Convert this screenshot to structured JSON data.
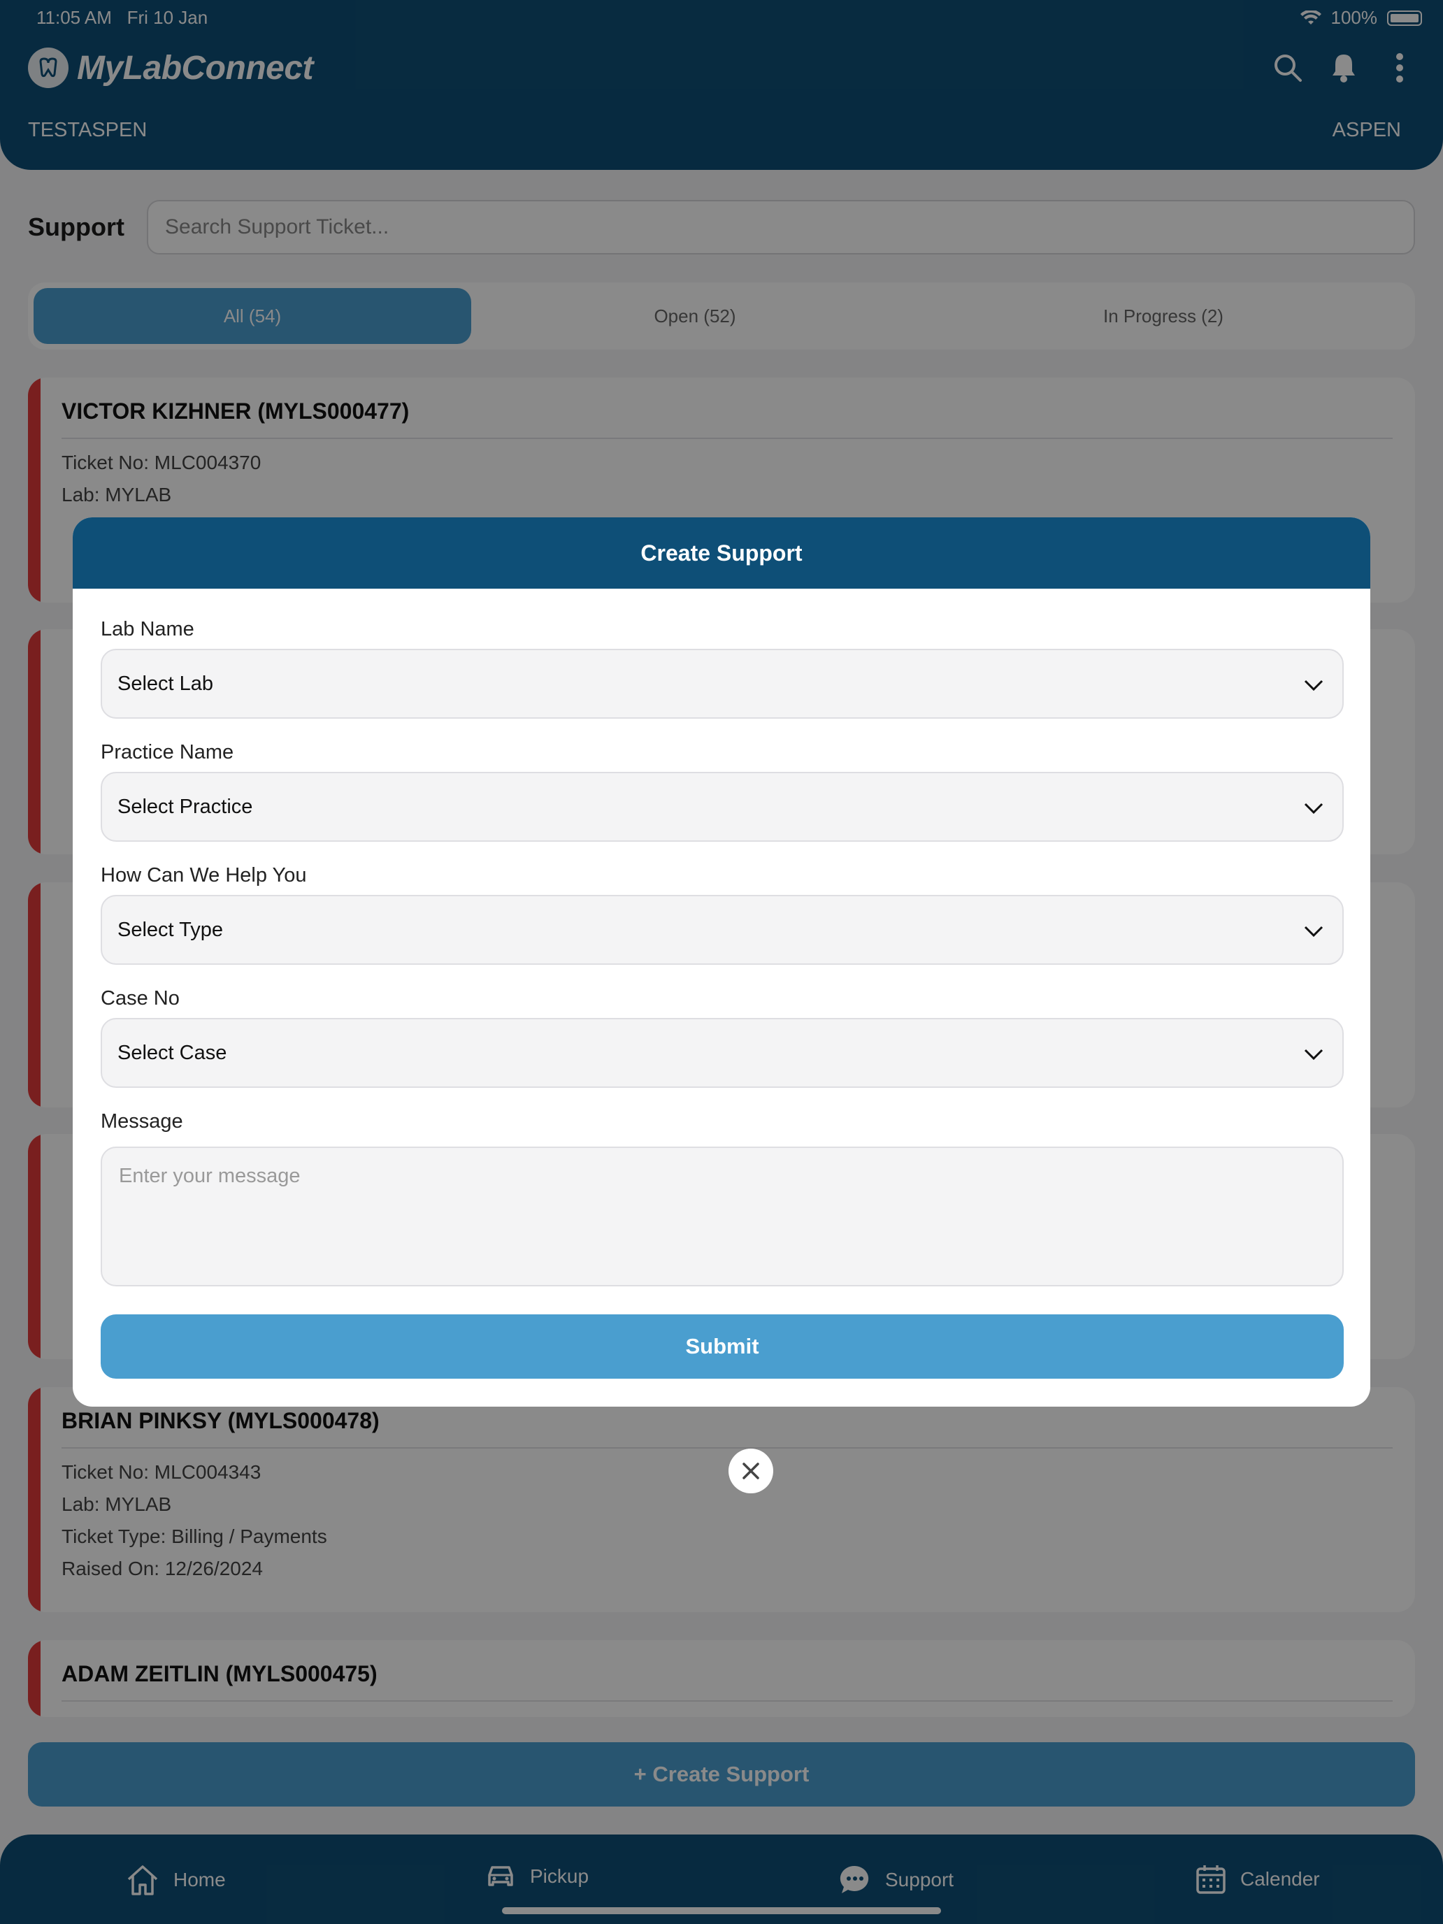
{
  "status_bar": {
    "time": "11:05 AM",
    "date": "Fri 10 Jan",
    "battery": "100%"
  },
  "header": {
    "app_name": "MyLabConnect",
    "org_left": "TESTASPEN",
    "org_right": "ASPEN",
    "icons": [
      "search-icon",
      "bell-icon",
      "more-vertical-icon"
    ]
  },
  "page": {
    "title": "Support",
    "search_placeholder": "Search Support Ticket..."
  },
  "tabs": [
    {
      "label": "All (54)",
      "active": true
    },
    {
      "label": "Open (52)",
      "active": false
    },
    {
      "label": "In Progress (2)",
      "active": false
    }
  ],
  "cards": [
    {
      "title": "VICTOR KIZHNER (MYLS000477)",
      "lines": [
        "Ticket No: MLC004370",
        "Lab: MYLAB"
      ]
    },
    {
      "title": "BRIAN PINKSY (MYLS000478)",
      "lines": [
        "Ticket No: MLC004343",
        "Lab: MYLAB",
        "Ticket Type: Billing / Payments",
        "Raised On: 12/26/2024"
      ]
    },
    {
      "title": "ADAM ZEITLIN (MYLS000475)",
      "lines": []
    }
  ],
  "create_button": "+ Create Support",
  "bottom_nav": [
    {
      "label": "Home",
      "icon": "home-icon",
      "active": false
    },
    {
      "label": "Pickup",
      "icon": "car-icon",
      "active": false
    },
    {
      "label": "Support",
      "icon": "chat-icon",
      "active": true
    },
    {
      "label": "Calender",
      "icon": "calendar-icon",
      "active": false
    }
  ],
  "modal": {
    "title": "Create Support",
    "fields": [
      {
        "label": "Lab Name",
        "value": "Select Lab"
      },
      {
        "label": "Practice Name",
        "value": "Select Practice"
      },
      {
        "label": "How Can We Help You",
        "value": "Select Type"
      },
      {
        "label": "Case No",
        "value": "Select Case"
      }
    ],
    "message_label": "Message",
    "message_placeholder": "Enter your message",
    "submit": "Submit"
  },
  "colors": {
    "primary": "#0e4f77",
    "accent": "#4a9ecf",
    "status_red": "#e03a3a"
  }
}
